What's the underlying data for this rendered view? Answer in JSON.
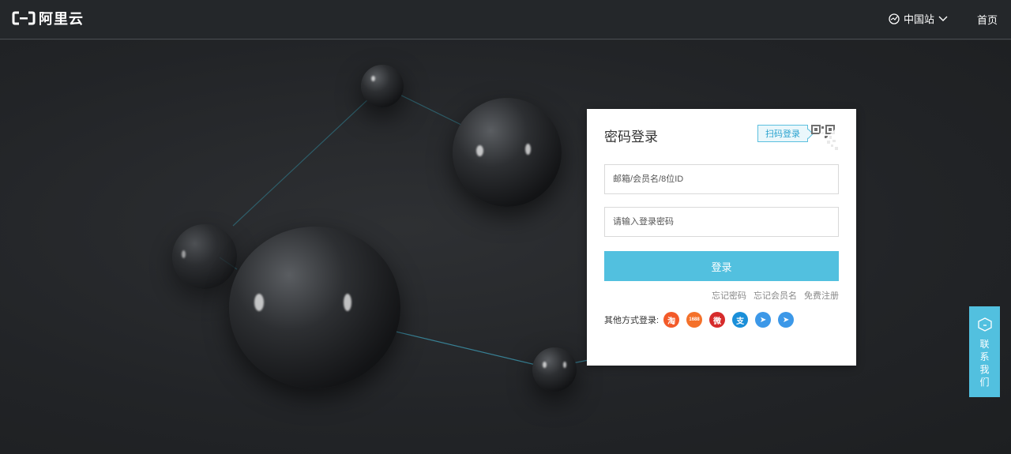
{
  "header": {
    "logo_text": "阿里云",
    "region_label": "中国站",
    "home_link": "首页"
  },
  "login": {
    "title": "密码登录",
    "qr_tip": "扫码登录",
    "username_placeholder": "邮箱/会员名/8位ID",
    "password_placeholder": "请输入登录密码",
    "submit_label": "登录",
    "links": [
      "忘记密码",
      "忘记会员名",
      "免费注册"
    ],
    "other_label": "其他方式登录:",
    "social": [
      {
        "name": "taobao",
        "glyph": "淘",
        "color": "#f35a29"
      },
      {
        "name": "1688",
        "glyph": "1688",
        "color": "#f4712a"
      },
      {
        "name": "weibo",
        "glyph": "微",
        "color": "#d62b2b"
      },
      {
        "name": "alipay",
        "glyph": "支",
        "color": "#1a8fd9"
      },
      {
        "name": "dingtalk",
        "glyph": "➤",
        "color": "#3c98e8"
      },
      {
        "name": "telegram",
        "glyph": "➤",
        "color": "#3c98e8"
      }
    ]
  },
  "contact": {
    "label": "联系我们"
  },
  "colors": {
    "accent": "#52c0df",
    "topbar": "#24272a"
  }
}
